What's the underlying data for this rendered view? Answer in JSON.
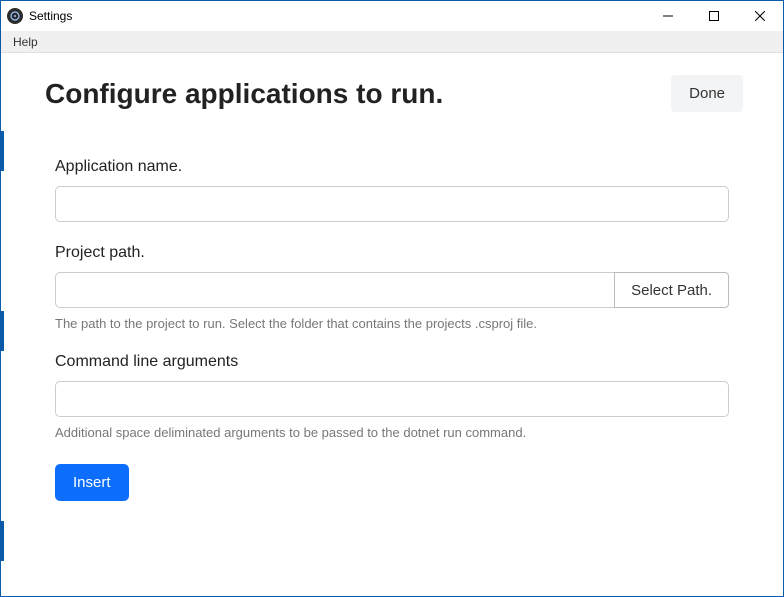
{
  "window": {
    "title": "Settings"
  },
  "menubar": {
    "help": "Help"
  },
  "header": {
    "title": "Configure applications to run.",
    "done_label": "Done"
  },
  "form": {
    "app_name": {
      "label": "Application name.",
      "value": ""
    },
    "project_path": {
      "label": "Project path.",
      "value": "",
      "select_label": "Select Path.",
      "help": "The path to the project to run. Select the folder that contains the projects .csproj file."
    },
    "args": {
      "label": "Command line arguments",
      "value": "",
      "help": "Additional space deliminated arguments to be passed to the dotnet run command."
    },
    "insert_label": "Insert"
  }
}
